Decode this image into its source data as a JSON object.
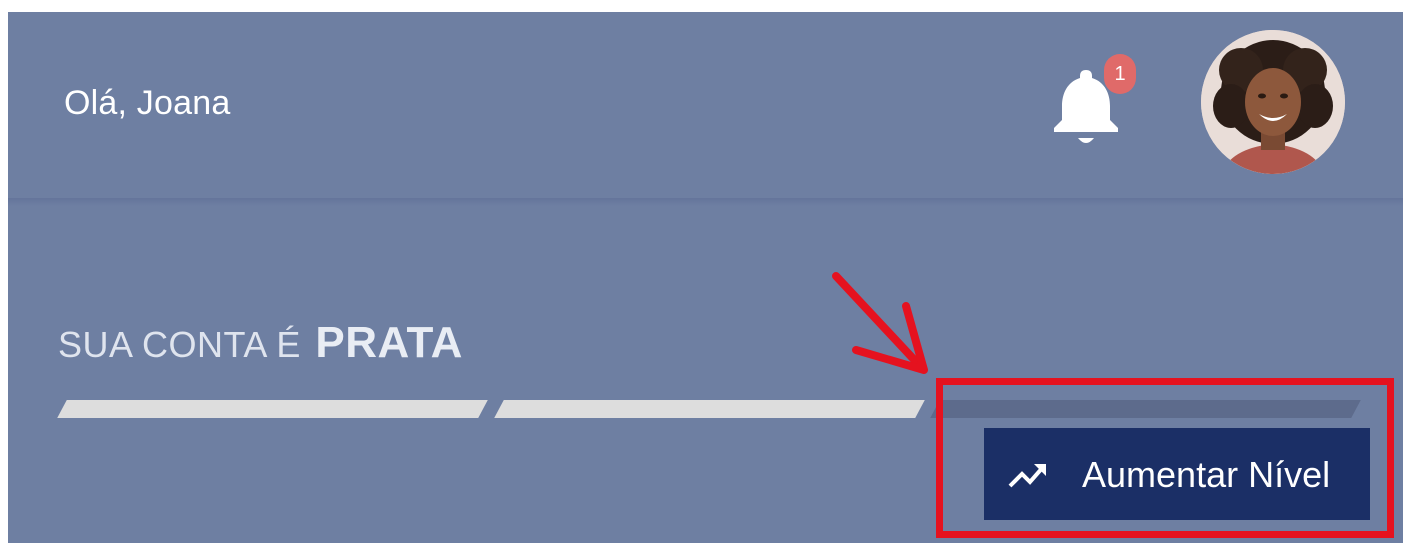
{
  "header": {
    "greeting": "Olá, Joana",
    "notifications": {
      "icon": "bell-icon",
      "badge_count": "1",
      "badge_color": "#e06a69"
    },
    "avatar": {
      "icon": "user-avatar"
    }
  },
  "account": {
    "prefix": "SUA CONTA É",
    "tier": "PRATA",
    "level_progress": {
      "filled_segments": 2,
      "total_segments": 3
    }
  },
  "upgrade_button": {
    "label": "Aumentar Nível",
    "icon": "trending-up-icon",
    "background": "#1b2f66"
  },
  "annotation": {
    "color": "#e5121f",
    "icon": "arrow-annotation"
  },
  "colors": {
    "header_bg": "#6e7fa2",
    "progress_filled": "#dddddd",
    "progress_empty": "#5d6b8c"
  }
}
